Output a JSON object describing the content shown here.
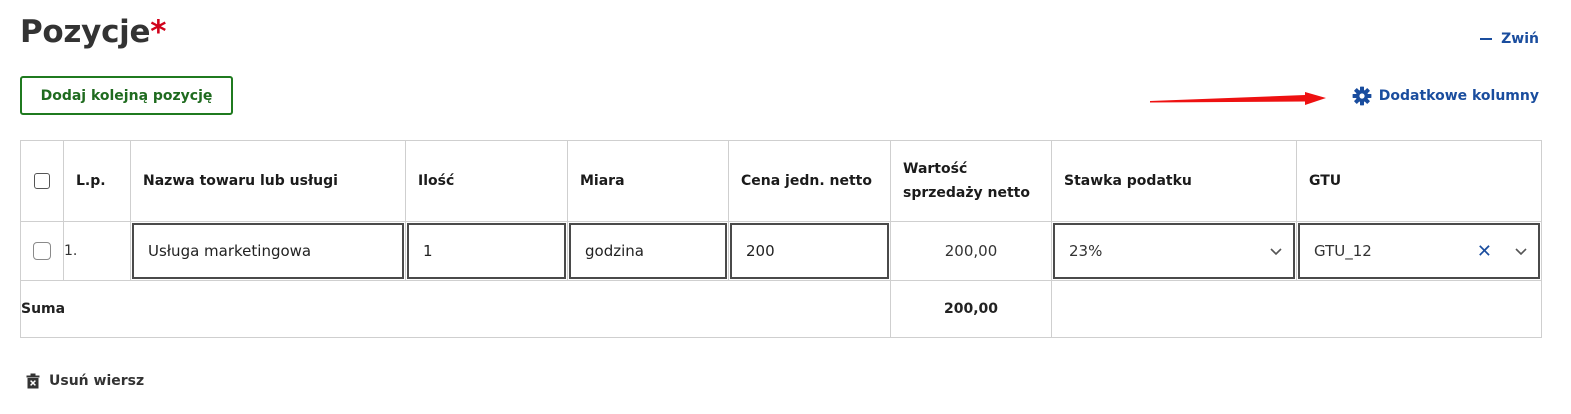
{
  "header": {
    "title": "Pozycje",
    "required_mark": "*",
    "collapse_label": "Zwiń",
    "add_button_label": "Dodaj kolejną pozycję",
    "extra_columns_label": "Dodatkowe kolumny"
  },
  "table": {
    "headers": {
      "lp": "L.p.",
      "name": "Nazwa towaru lub usługi",
      "qty": "Ilość",
      "unit": "Miara",
      "unit_price": "Cena jedn. netto",
      "net_value": "Wartość sprzedaży netto",
      "tax_rate": "Stawka podatku",
      "gtu": "GTU"
    },
    "rows": [
      {
        "selected": false,
        "lp": "1.",
        "name": "Usługa marketingowa",
        "qty": "1",
        "unit": "godzina",
        "unit_price": "200",
        "net_value": "200,00",
        "tax_rate": "23%",
        "gtu": "GTU_12"
      }
    ],
    "sum_label": "Suma",
    "sum_value": "200,00"
  },
  "footer": {
    "delete_label": "Usuń wiersz"
  },
  "icons": {
    "collapse": "minus-icon",
    "settings": "gear-icon",
    "annotation": "red-arrow-icon",
    "clear": "close-icon",
    "dropdown": "chevron-down-icon",
    "delete": "trash-icon"
  },
  "colors": {
    "link": "#1a4d9e",
    "primary_green": "#1f7a1f",
    "required": "#d0021b",
    "annotation_arrow": "#ee1111"
  }
}
